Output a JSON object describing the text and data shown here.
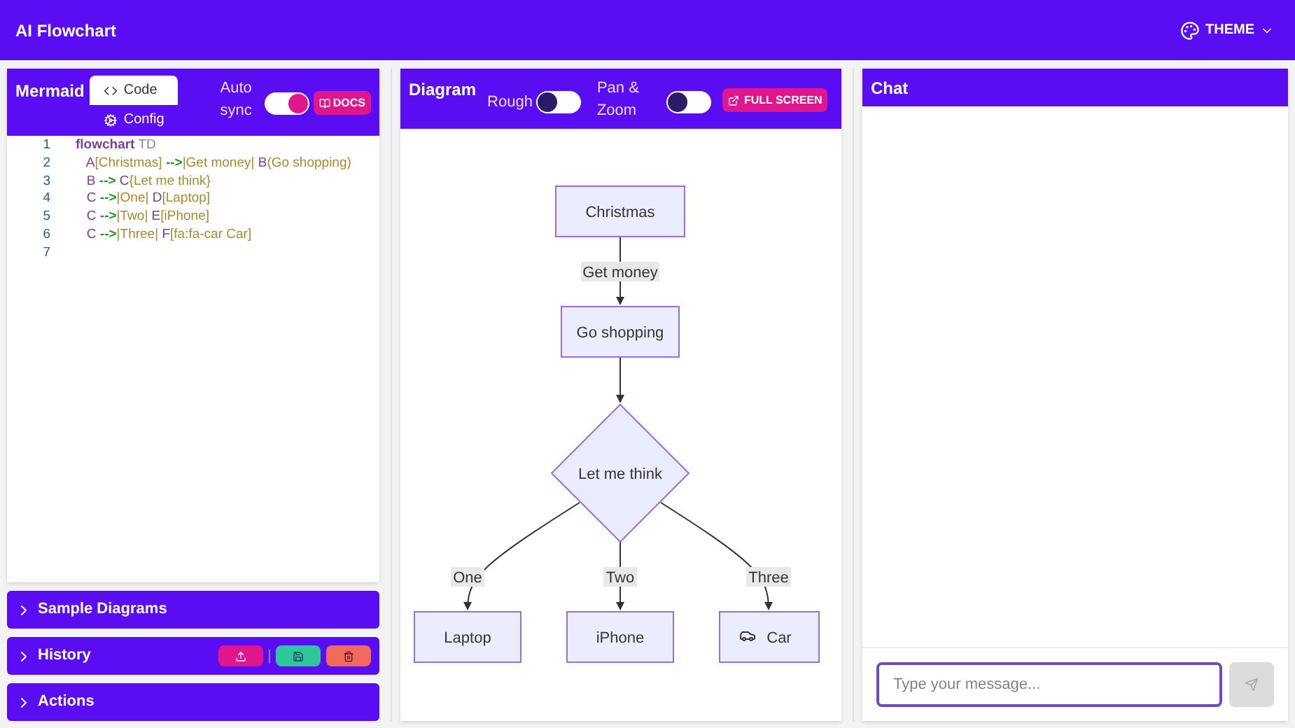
{
  "app_bar": {
    "title": "AI Flowchart",
    "theme_button": "THEME"
  },
  "editor": {
    "title": "Mermaid",
    "tabs": [
      {
        "label": "Code",
        "selected": true
      },
      {
        "label": "Config",
        "selected": false
      }
    ],
    "auto_sync": {
      "label": "Auto sync",
      "on": true
    },
    "docs_button": "DOCS",
    "lines": [
      {
        "number": "1",
        "tokens": [
          {
            "kind": "keyword",
            "text": "flowchart"
          },
          {
            "kind": "plain",
            "text": " TD"
          }
        ]
      },
      {
        "number": "2",
        "tokens": [
          {
            "kind": "id",
            "text": "A"
          },
          {
            "kind": "label",
            "text": "[Christmas] "
          },
          {
            "kind": "arrow",
            "text": "-->"
          },
          {
            "kind": "label",
            "text": "|Get money| "
          },
          {
            "kind": "id",
            "text": "B"
          },
          {
            "kind": "label",
            "text": "(Go shopping)"
          }
        ]
      },
      {
        "number": "3",
        "tokens": [
          {
            "kind": "id",
            "text": "B "
          },
          {
            "kind": "arrow",
            "text": "-->"
          },
          {
            "kind": "id",
            "text": " C"
          },
          {
            "kind": "label",
            "text": "{Let me think}"
          }
        ]
      },
      {
        "number": "4",
        "tokens": [
          {
            "kind": "id",
            "text": "C "
          },
          {
            "kind": "arrow",
            "text": "-->"
          },
          {
            "kind": "label",
            "text": "|One| "
          },
          {
            "kind": "id",
            "text": "D"
          },
          {
            "kind": "label",
            "text": "[Laptop]"
          }
        ]
      },
      {
        "number": "5",
        "tokens": [
          {
            "kind": "id",
            "text": "C "
          },
          {
            "kind": "arrow",
            "text": "-->"
          },
          {
            "kind": "label",
            "text": "|Two| "
          },
          {
            "kind": "id",
            "text": "E"
          },
          {
            "kind": "label",
            "text": "[iPhone]"
          }
        ]
      },
      {
        "number": "6",
        "tokens": [
          {
            "kind": "id",
            "text": "C "
          },
          {
            "kind": "arrow",
            "text": "-->"
          },
          {
            "kind": "label",
            "text": "|Three| "
          },
          {
            "kind": "id",
            "text": "F"
          },
          {
            "kind": "label",
            "text": "[fa:fa-car Car]"
          }
        ]
      },
      {
        "number": "7"
      }
    ]
  },
  "sections": [
    {
      "title": "Sample Diagrams",
      "kind": "plain"
    },
    {
      "title": "History",
      "kind": "history"
    },
    {
      "title": "Actions",
      "kind": "plain"
    }
  ],
  "diagram": {
    "title": "Diagram",
    "rough": {
      "label": "Rough",
      "on": false
    },
    "pan_zoom": {
      "label": "Pan & Zoom",
      "on": false
    },
    "fullscreen_button": "FULL SCREEN",
    "nodes": [
      "Christmas",
      "Go shopping",
      "Let me think",
      "Laptop",
      "iPhone",
      "Car"
    ],
    "edge_labels": [
      "Get money",
      "One",
      "Two",
      "Three"
    ]
  },
  "chat": {
    "title": "Chat",
    "placeholder": "Type your message..."
  }
}
